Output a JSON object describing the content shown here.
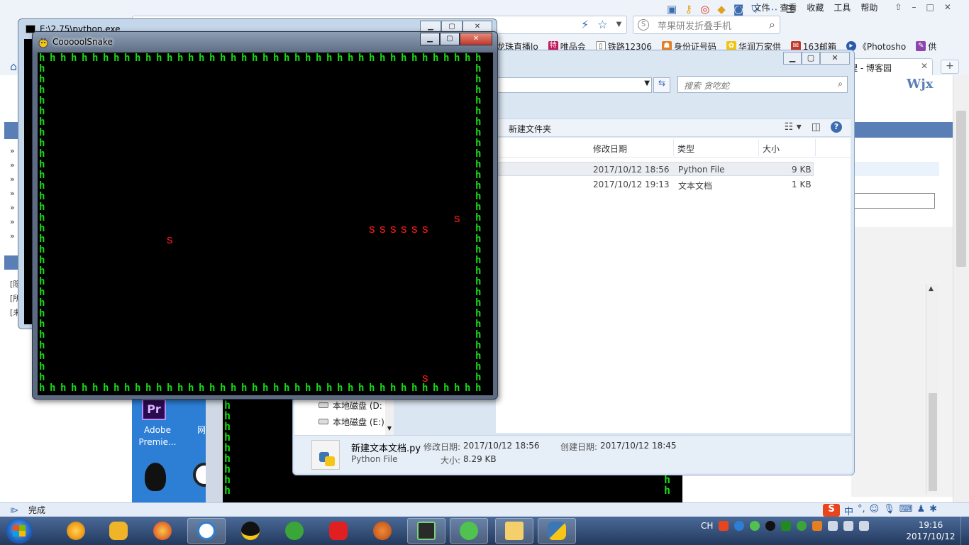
{
  "browser": {
    "menu": [
      "文件",
      "查看",
      "收藏",
      "工具",
      "帮助"
    ],
    "search_placeholder": "苹果研发折叠手机",
    "favorites": [
      {
        "label": "龙珠直播lo",
        "icon_color": "#f39c12"
      },
      {
        "label": "唯品会",
        "icon_color": "#c2185b"
      },
      {
        "label": "铁路12306",
        "icon_color": "#1e6fbf"
      },
      {
        "label": "身份证号码",
        "icon_color": "#e67e22"
      },
      {
        "label": "华润万家供",
        "icon_color": "#f1c40f"
      },
      {
        "label": "163邮箱",
        "icon_color": "#c0392b"
      },
      {
        "label": "《Photosho",
        "icon_color": "#2b5aa8"
      },
      {
        "label": "供",
        "icon_color": "#8e44ad"
      }
    ],
    "active_tab": "台管理 - 博客园",
    "site_logo": "Wjx",
    "status": "完成",
    "left_links": [
      "[隐",
      "[所",
      "[未"
    ]
  },
  "explorer": {
    "search_placeholder": "搜索 贪吃蛇",
    "new_folder": "新建文件夹",
    "columns": {
      "date": "修改日期",
      "type": "类型",
      "size": "大小"
    },
    "rows": [
      {
        "date": "2017/10/12 18:56",
        "type": "Python File",
        "size": "9 KB"
      },
      {
        "date": "2017/10/12 19:13",
        "type": "文本文档",
        "size": "1 KB"
      }
    ],
    "nav_items": [
      "本地磁盘 (D:",
      "本地磁盘 (E:)"
    ],
    "details": {
      "filename": "新建文本文档.py",
      "filetype": "Python File",
      "modified_label": "修改日期:",
      "modified_value": "2017/10/12 18:56",
      "created_label": "创建日期:",
      "created_value": "2017/10/12 18:45",
      "size_label": "大小:",
      "size_value": "8.29 KB"
    }
  },
  "console": {
    "title": "E:\\2.75\\python.exe"
  },
  "snake_window": {
    "title": "CooooolSnake",
    "wall_char": "h",
    "grid": {
      "cols": 42,
      "rows": 32
    },
    "snake_char": "s",
    "snake_cells": [
      [
        31,
        16
      ],
      [
        32,
        16
      ],
      [
        33,
        16
      ],
      [
        34,
        16
      ],
      [
        35,
        16
      ],
      [
        36,
        16
      ]
    ],
    "food_char": "s",
    "food_cells": [
      [
        12,
        17
      ],
      [
        39,
        15
      ],
      [
        36,
        30
      ]
    ],
    "colors": {
      "wall": "#16d916",
      "snake": "#ff1a1a",
      "background": "#000000"
    }
  },
  "desktop": {
    "icons": [
      {
        "label": "Adobe",
        "label2": "Premie..."
      },
      {
        "label": "网易",
        "label2": ""
      }
    ]
  },
  "taskbar": {
    "lang": "CH",
    "time": "19:16",
    "date": "2017/10/12",
    "apps": [
      "ie-browser",
      "cat-game",
      "crossfire",
      "sogou-browser",
      "qq",
      "wifi",
      "netease-music",
      "basketball",
      "pc-monitor",
      "wechat",
      "file-explorer",
      "python"
    ]
  }
}
